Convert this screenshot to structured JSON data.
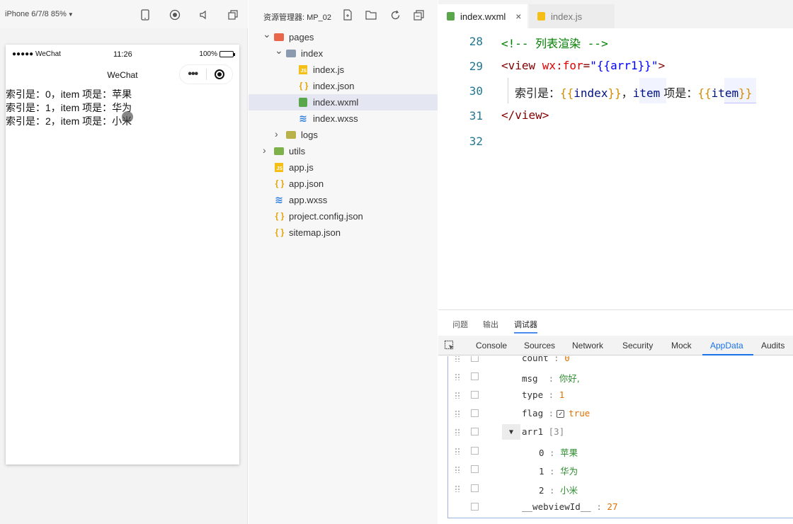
{
  "simulator": {
    "device_label": "iPhone 6/7/8 85%",
    "status_carrier": "●●●●● WeChat",
    "status_time": "11:26",
    "status_battery_text": "100%",
    "battery_level": 1.0,
    "nav_title": "WeChat",
    "capsule_more": "•••",
    "lines": [
      "索引是：0，item 项是：苹果",
      "索引是：1，item 项是：华为",
      "索引是：2，item 项是：小米"
    ]
  },
  "explorer": {
    "title": "资源管理器: MP_02",
    "tree": [
      {
        "label": "pages",
        "type": "folder",
        "color": "#e8664a",
        "depth": 0,
        "expanded": true
      },
      {
        "label": "index",
        "type": "folder",
        "color": "#8a9bb0",
        "depth": 1,
        "expanded": true
      },
      {
        "label": "index.js",
        "type": "js",
        "depth": 2
      },
      {
        "label": "index.json",
        "type": "json",
        "depth": 2
      },
      {
        "label": "index.wxml",
        "type": "wxml",
        "depth": 2,
        "selected": true
      },
      {
        "label": "index.wxss",
        "type": "wxss",
        "depth": 2
      },
      {
        "label": "logs",
        "type": "folder",
        "color": "#b9b24a",
        "depth": 1,
        "expanded": false
      },
      {
        "label": "utils",
        "type": "folder",
        "color": "#7db24a",
        "depth": 0,
        "expanded": false
      },
      {
        "label": "app.js",
        "type": "js",
        "depth": 0
      },
      {
        "label": "app.json",
        "type": "json",
        "depth": 0
      },
      {
        "label": "app.wxss",
        "type": "wxss",
        "depth": 0
      },
      {
        "label": "project.config.json",
        "type": "json",
        "depth": 0
      },
      {
        "label": "sitemap.json",
        "type": "json",
        "depth": 0
      }
    ]
  },
  "editor": {
    "tabs": [
      {
        "label": "index.wxml",
        "active": true,
        "close": "×"
      },
      {
        "label": "index.js",
        "active": false
      }
    ],
    "lines": [
      {
        "num": "28",
        "text": "<!-- 列表渲染 -->"
      },
      {
        "num": "29",
        "text": "<view wx:for=\"{{arr1}}\">"
      },
      {
        "num": "30",
        "text": "索引是：{{index}}，item 项是：{{item}}"
      },
      {
        "num": "31",
        "text": "</view>"
      },
      {
        "num": "32",
        "text": ""
      }
    ],
    "line29": {
      "open": "<view ",
      "attr": "wx:for",
      "eq": "=",
      "str": "\"{{arr1}}\"",
      "close": ">"
    },
    "line30": {
      "t1": "索引是：",
      "b1": "{{",
      "v1": "index",
      "b2": "}}",
      "t2": "，",
      "v2": "item",
      "t3": " 项是：",
      "b3": "{{",
      "v3": "item",
      "b4": "}}"
    }
  },
  "bottom_panel": {
    "tabs": [
      "问题",
      "输出",
      "调试器"
    ],
    "active_tab": "调试器",
    "devtools_tabs": [
      "Console",
      "Sources",
      "Network",
      "Security",
      "Mock",
      "AppData",
      "Audits"
    ],
    "active_devtools_tab": "AppData"
  },
  "appdata": {
    "count_key": "count",
    "count_value": "0",
    "msg_key": "msg",
    "msg_value": "你好,",
    "type_key": "type",
    "type_value": "1",
    "flag_key": "flag",
    "flag_checked": true,
    "flag_value": "true",
    "arr_key": "arr1",
    "arr_len": "[3]",
    "arr_items": [
      {
        "index": "0",
        "value": "苹果"
      },
      {
        "index": "1",
        "value": "华为"
      },
      {
        "index": "2",
        "value": "小米"
      }
    ],
    "webview_key": "__webviewId__",
    "webview_value": "27"
  }
}
